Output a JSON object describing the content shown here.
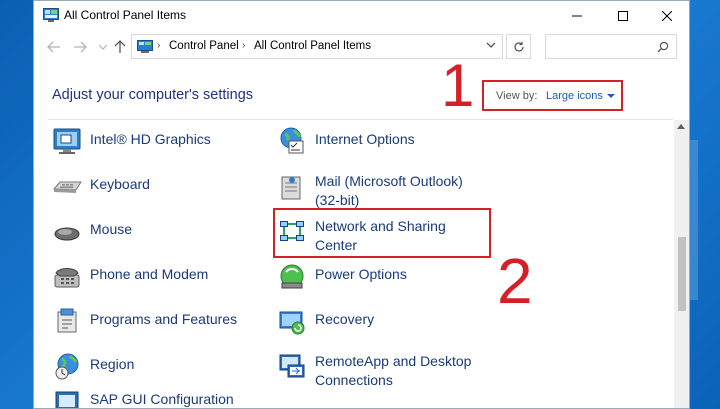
{
  "window": {
    "title": "All Control Panel Items",
    "controls": {
      "minimize": "minimize-icon",
      "maximize": "maximize-icon",
      "close": "close-icon"
    }
  },
  "address": {
    "crumbs": [
      "Control Panel",
      "All Control Panel Items"
    ],
    "search_placeholder": ""
  },
  "header": {
    "title": "Adjust your computer's settings",
    "view_by_label": "View by:",
    "view_by_value": "Large icons"
  },
  "annotations": {
    "one": "1",
    "two": "2"
  },
  "items_left": [
    {
      "label": "Intel® HD Graphics",
      "icon": "intel-graphics-icon"
    },
    {
      "label": "Keyboard",
      "icon": "keyboard-icon"
    },
    {
      "label": "Mouse",
      "icon": "mouse-icon"
    },
    {
      "label": "Phone and Modem",
      "icon": "phone-modem-icon"
    },
    {
      "label": "Programs and Features",
      "icon": "programs-icon"
    },
    {
      "label": "Region",
      "icon": "region-icon"
    },
    {
      "label": "SAP GUI Configuration",
      "icon": "sap-gui-icon"
    }
  ],
  "items_right": [
    {
      "label": "Internet Options",
      "icon": "internet-options-icon"
    },
    {
      "label": "Mail (Microsoft Outlook)",
      "label2": "(32-bit)",
      "icon": "mail-icon"
    },
    {
      "label": "Network and Sharing",
      "label2": "Center",
      "icon": "network-sharing-icon"
    },
    {
      "label": "Power Options",
      "icon": "power-options-icon"
    },
    {
      "label": "Recovery",
      "icon": "recovery-icon"
    },
    {
      "label": "RemoteApp and Desktop",
      "label2": "Connections",
      "icon": "remoteapp-icon"
    }
  ],
  "colors": {
    "accent": "#d42027",
    "link": "#1a5fb4",
    "heading": "#1e3287"
  }
}
